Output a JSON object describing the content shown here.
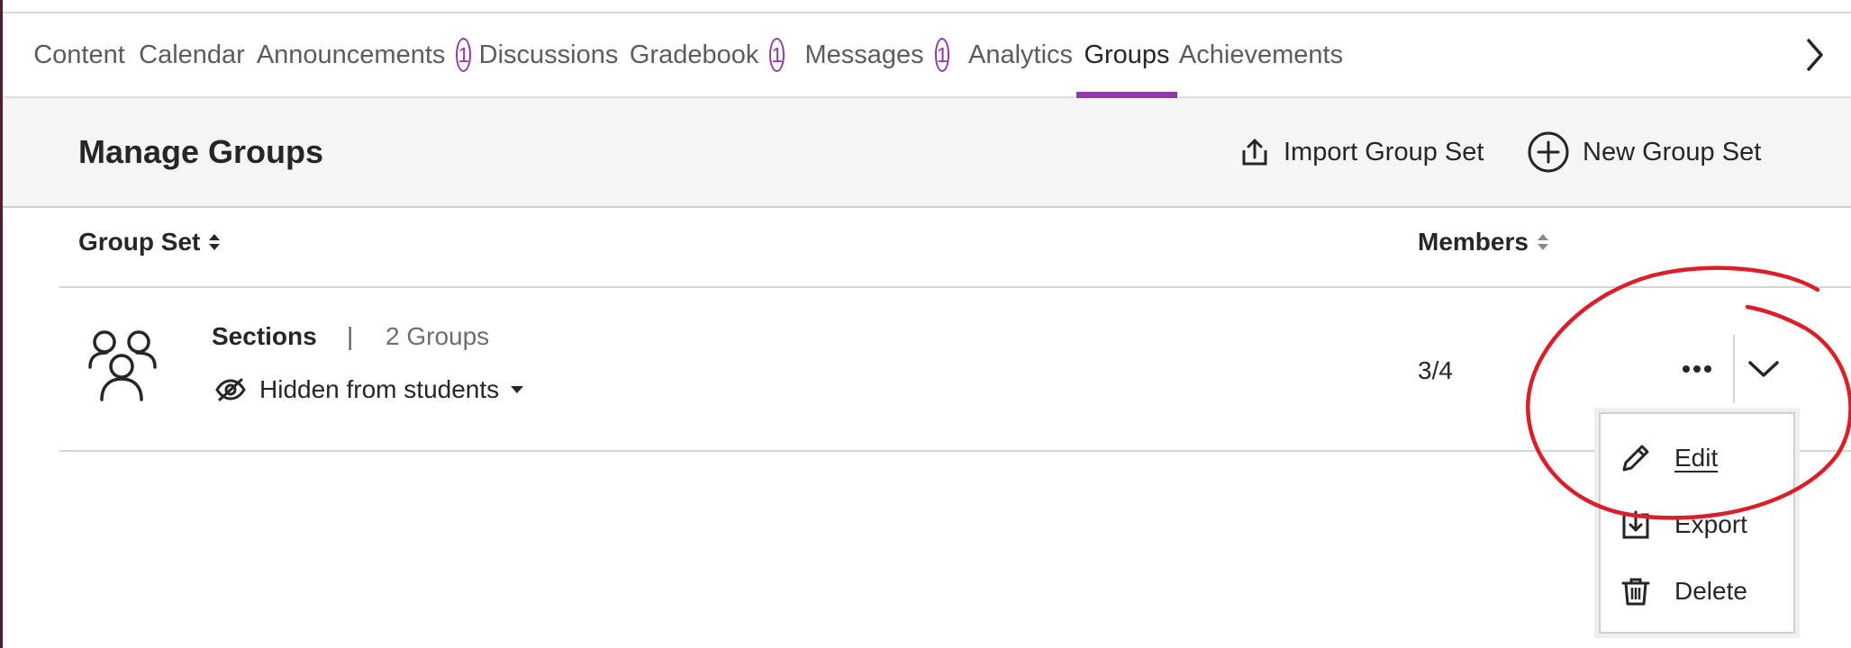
{
  "tabs": [
    {
      "label": "Content"
    },
    {
      "label": "Calendar"
    },
    {
      "label": "Announcements",
      "badge": "1"
    },
    {
      "label": "Discussions"
    },
    {
      "label": "Gradebook",
      "badge": "1"
    },
    {
      "label": "Messages",
      "badge": "1"
    },
    {
      "label": "Analytics"
    },
    {
      "label": "Groups",
      "active": true
    },
    {
      "label": "Achievements"
    }
  ],
  "header": {
    "title": "Manage Groups",
    "import_label": "Import Group Set",
    "new_label": "New Group Set"
  },
  "table": {
    "columns": {
      "group_set": "Group Set",
      "members": "Members"
    },
    "rows": [
      {
        "name": "Sections",
        "separator": "|",
        "groups": "2 Groups",
        "visibility": "Hidden from students",
        "members": "3/4"
      }
    ]
  },
  "menu": {
    "items": [
      {
        "label": "Edit",
        "icon": "pencil-icon"
      },
      {
        "label": "Export",
        "icon": "export-icon"
      },
      {
        "label": "Delete",
        "icon": "trash-icon"
      }
    ]
  },
  "colors": {
    "accent": "#8e3ba6",
    "annotation": "#d9202a",
    "header_bg": "#f5f5f5"
  }
}
